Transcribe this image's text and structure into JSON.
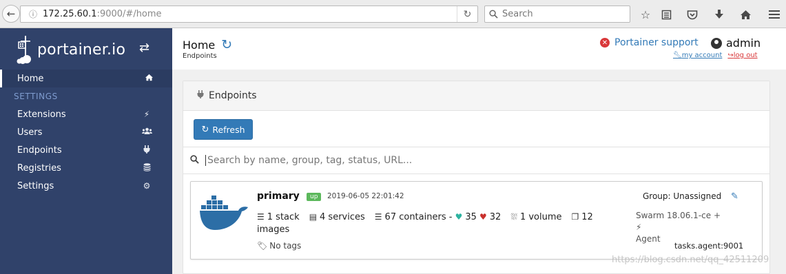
{
  "browser": {
    "url_host": "172.25.60.1",
    "url_rest": ":9000/#/home",
    "search_placeholder": "Search"
  },
  "sidebar": {
    "brand": "portainer.io",
    "items": [
      {
        "label": "Home",
        "icon": "home-icon"
      },
      {
        "label": "Extensions",
        "icon": "bolt-icon"
      },
      {
        "label": "Users",
        "icon": "users-icon"
      },
      {
        "label": "Endpoints",
        "icon": "plug-icon"
      },
      {
        "label": "Registries",
        "icon": "database-icon"
      },
      {
        "label": "Settings",
        "icon": "cogs-icon"
      }
    ],
    "heading": "SETTINGS"
  },
  "header": {
    "title": "Home",
    "breadcrumb": "Endpoints",
    "support_label": "Portainer support",
    "username": "admin",
    "my_account": "my account",
    "log_out": "log out"
  },
  "widget": {
    "title": "Endpoints",
    "refresh_label": "Refresh",
    "search_placeholder": "Search by name, group, tag, status, URL..."
  },
  "endpoint": {
    "name": "primary",
    "status": "up",
    "date": "2019-06-05 22:01:42",
    "stacks": "1 stack",
    "services": "4 services",
    "containers": "67 containers -",
    "healthy": "35",
    "unhealthy": "32",
    "volumes": "1 volume",
    "images_count": "12",
    "images_label": "images",
    "tags": "No tags",
    "group": "Group: Unassigned",
    "swarm": "Swarm 18.06.1-ce +",
    "agent": "Agent",
    "url": "tasks.agent:9001"
  },
  "colors": {
    "sidebar_bg": "#30426a",
    "accent": "#337ab7",
    "status_up": "#5cb85c",
    "danger": "#d9383a"
  },
  "watermark": "https://blog.csdn.net/qq_42511209"
}
